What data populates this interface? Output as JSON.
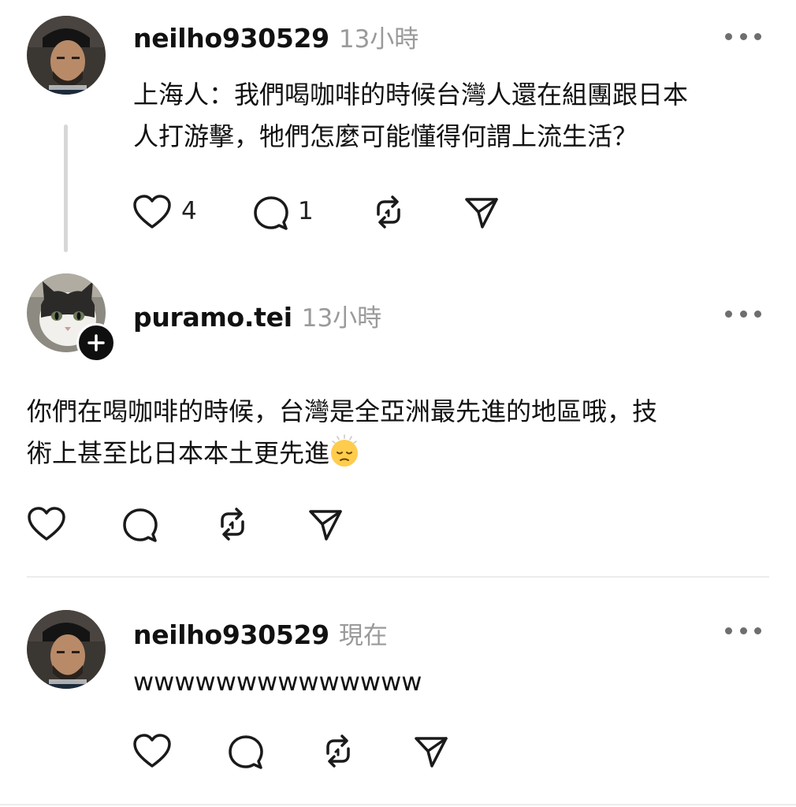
{
  "posts": [
    {
      "username": "neilho930529",
      "time": "13小時",
      "text_line1": "上海人：我們喝咖啡的時候台灣人還在組團跟日本",
      "text_line2": "人打游擊，牠們怎麼可能懂得何謂上流生活？",
      "likes": "4",
      "replies": "1"
    },
    {
      "username": "puramo.tei",
      "time": "13小時",
      "text_line1": "你們在喝咖啡的時候，台灣是全亞洲最先進的地區哦，技",
      "text_line2": "術上甚至比日本本土更先進",
      "emoji": "pensive-face-emoji"
    },
    {
      "username": "neilho930529",
      "time": "現在",
      "text_line1": "wwwwwwwwwwwwww"
    }
  ],
  "icons": {
    "like": "heart-icon",
    "reply": "comment-icon",
    "repost": "repost-icon",
    "share": "send-icon",
    "more": "more-icon",
    "follow": "plus-icon"
  },
  "colors": {
    "text": "#111111",
    "muted": "#9a9a9a",
    "icon": "#1a1a1a",
    "thread_line": "#d7d7d7",
    "divider": "#ececec"
  }
}
